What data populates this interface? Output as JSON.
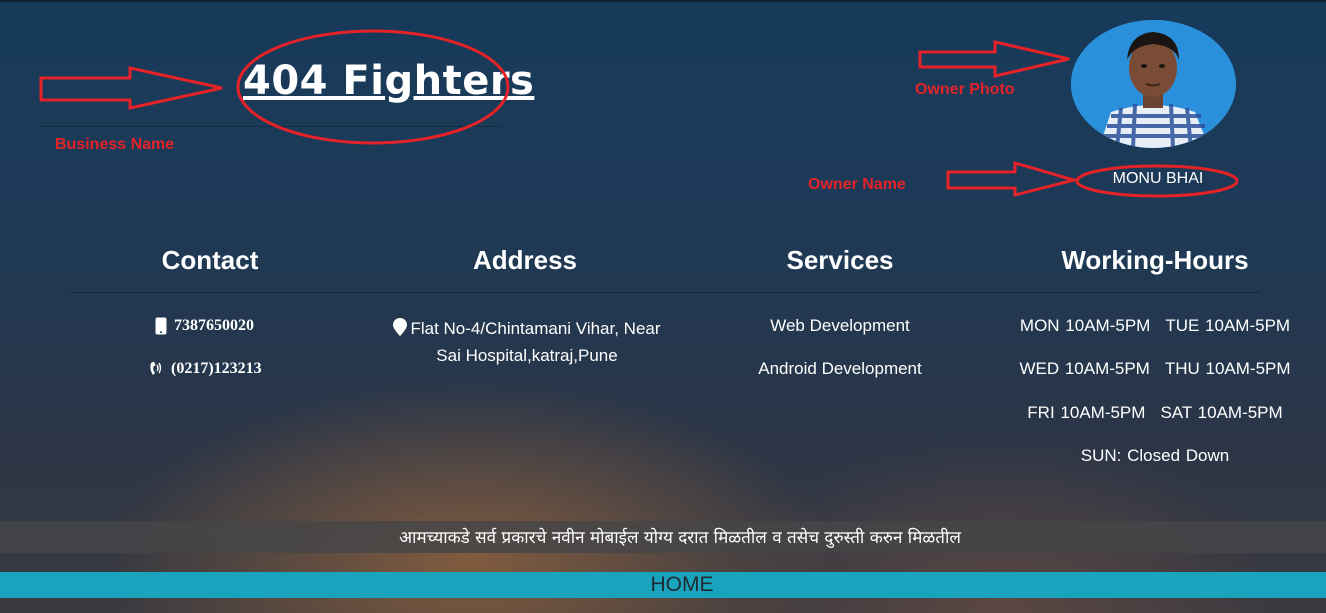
{
  "header": {
    "business_name": "404 Fighters",
    "owner_name": "MONU BHAI"
  },
  "annotations": {
    "business_name_label": "Business Name",
    "owner_photo_label": "Owner Photo",
    "owner_name_label": "Owner Name",
    "color": "#e52227"
  },
  "contact": {
    "heading": "Contact",
    "mobile": "7387650020",
    "landline": "(0217)123213"
  },
  "address": {
    "heading": "Address",
    "line1": "Flat No-4/Chintamani Vihar, Near",
    "line2": "Sai Hospital,katraj,Pune"
  },
  "services": {
    "heading": "Services",
    "items": [
      "Web Development",
      "Android Development"
    ]
  },
  "hours": {
    "heading": "Working-Hours",
    "mon": "MON 10AM-5PM",
    "tue": "TUE 10AM-5PM",
    "wed": "WED 10AM-5PM",
    "thu": "THU 10AM-5PM",
    "fri": "FRI 10AM-5PM",
    "sat": "SAT 10AM-5PM",
    "sun": "SUN: Closed Down"
  },
  "announcement": "आमच्याकडे सर्व प्रकारचे नवीन मोबाईल योग्य दरात मिळतील व तसेच दुरुस्ती करुन मिळतील",
  "nav": {
    "home": "HOME",
    "bar_color": "#1aa3bd"
  },
  "icons": [
    "mobile-phone-icon",
    "phone-volume-icon",
    "map-marker-icon"
  ]
}
